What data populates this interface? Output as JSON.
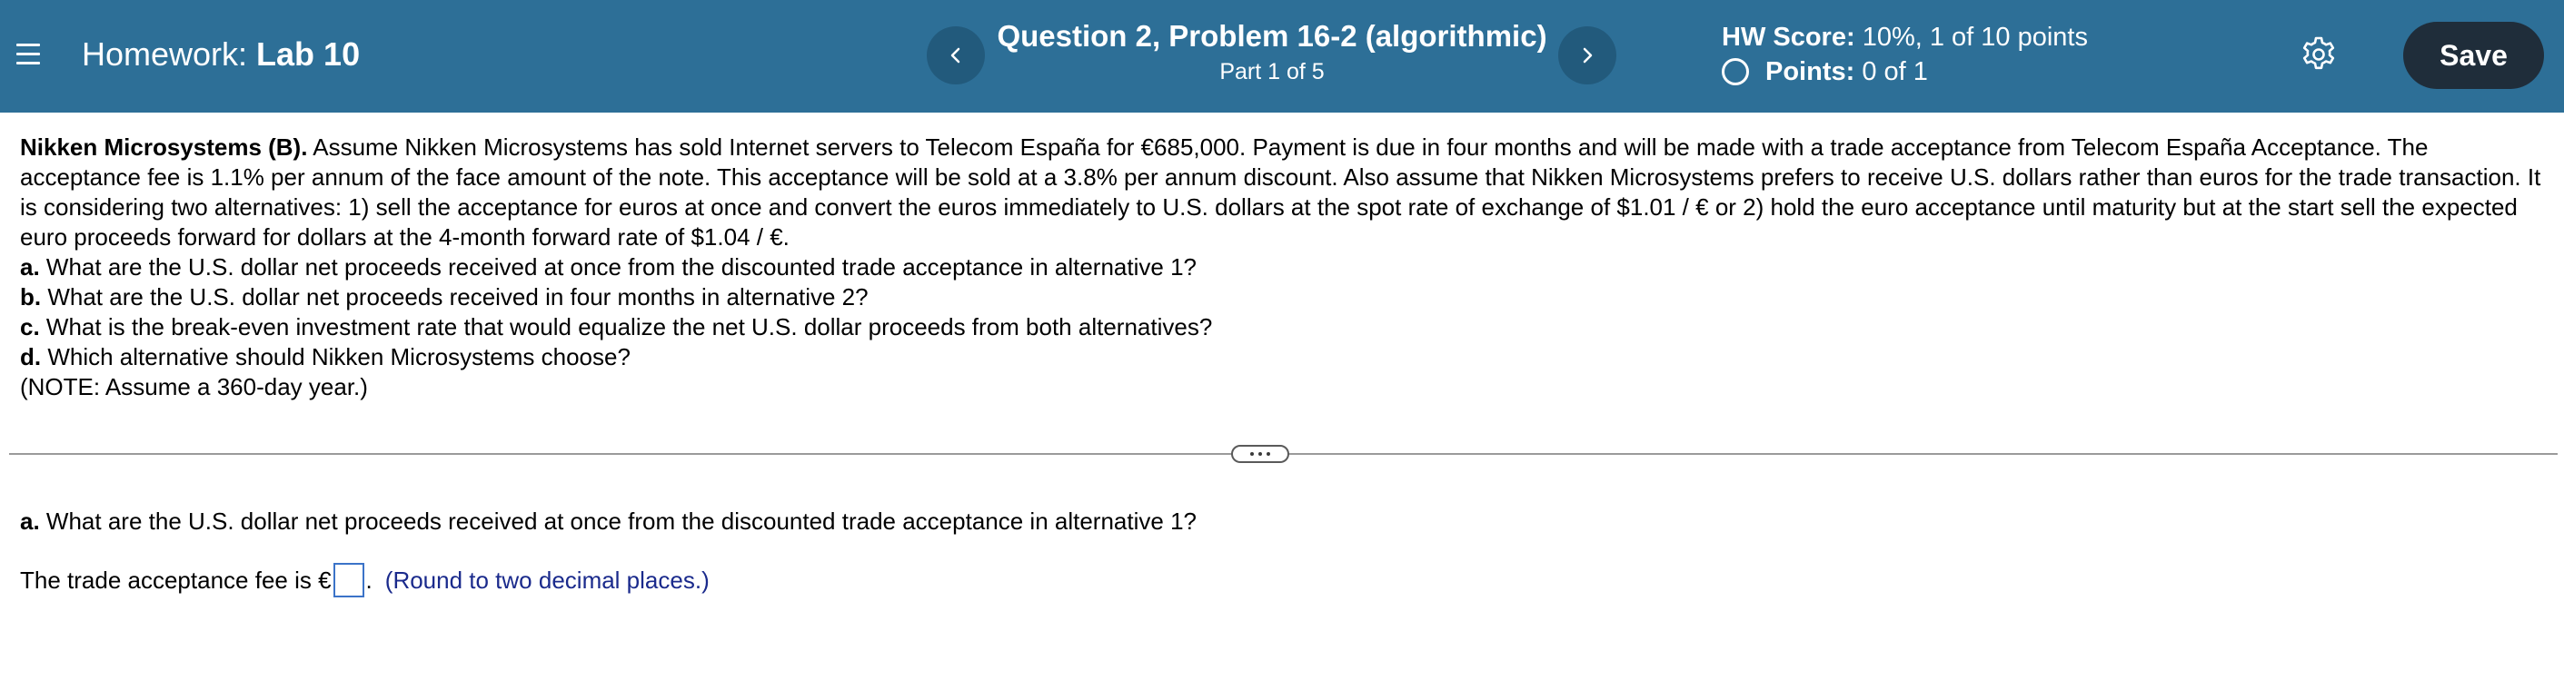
{
  "header": {
    "hw_label": "Homework:",
    "hw_name": "Lab 10",
    "question_title": "Question 2, Problem 16-2 (algorithmic)",
    "question_part": "Part 1 of 5",
    "score_label": "HW Score:",
    "score_value": "10%, 1 of 10 points",
    "points_label": "Points:",
    "points_value": "0 of 1",
    "save_label": "Save",
    "prev_icon": "chevron-left-icon",
    "next_icon": "chevron-right-icon",
    "menu_icon": "hamburger-menu-icon",
    "settings_icon": "gear-icon",
    "bg_color": "#2d6f97"
  },
  "problem": {
    "lead": "Nikken Microsystems (B).",
    "body": "Assume Nikken Microsystems has sold Internet servers to Telecom España for €685,000. Payment is due in four months and will be made with a trade acceptance from Telecom España Acceptance. The acceptance fee is 1.1% per annum of the face amount of the note. This acceptance will be sold at a 3.8% per annum discount. Also assume that Nikken Microsystems prefers to receive U.S. dollars rather than euros for the trade transaction. It is considering two alternatives: 1) sell the acceptance for euros at once and convert the euros immediately to U.S. dollars at the spot rate of exchange of $1.01 / € or 2) hold the euro acceptance until maturity but at the start sell the expected euro proceeds forward for dollars at the 4-month forward rate of $1.04 / €.",
    "questions": [
      {
        "letter": "a.",
        "text": "What are the U.S. dollar net proceeds received at once from the discounted trade acceptance in alternative 1?"
      },
      {
        "letter": "b.",
        "text": "What are the U.S. dollar net proceeds received in four months in alternative 2?"
      },
      {
        "letter": "c.",
        "text": "What is the break-even investment rate that would equalize the net U.S. dollar proceeds from both alternatives?"
      },
      {
        "letter": "d.",
        "text": "Which alternative should Nikken Microsystems choose?"
      }
    ],
    "note": "(NOTE: Assume a 360-day year.)"
  },
  "part": {
    "letter": "a.",
    "question": "What are the U.S. dollar net proceeds received at once from the discounted trade acceptance in alternative 1?",
    "answer_prefix": "The trade acceptance fee is €",
    "answer_value": "",
    "answer_suffix": ".",
    "hint": "(Round to two decimal places.)"
  }
}
